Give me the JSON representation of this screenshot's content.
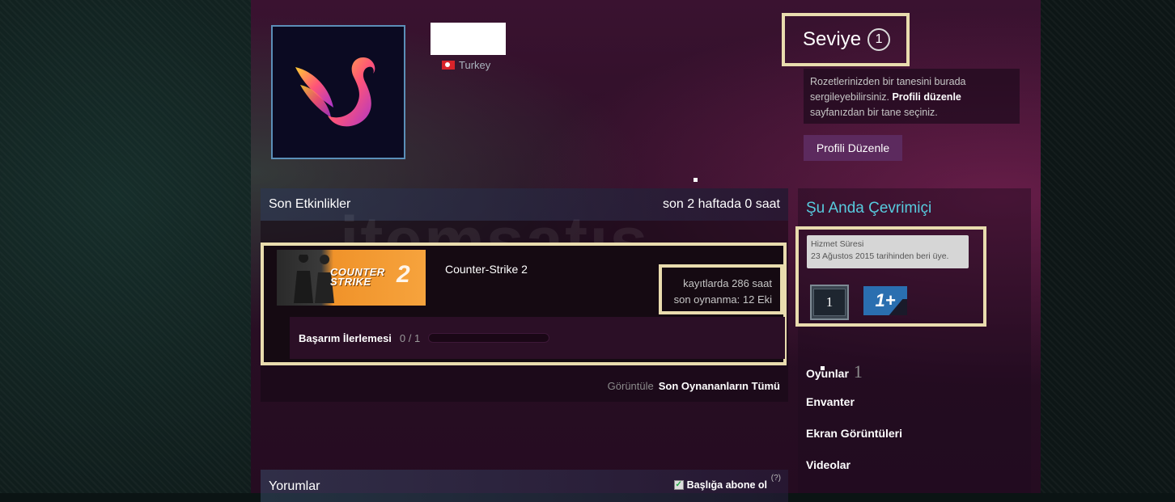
{
  "profile": {
    "country": "Turkey"
  },
  "level": {
    "label": "Seviye",
    "value": "1"
  },
  "badge_info": {
    "text": "Rozetlerinizden bir tanesini burada sergileyebilirsiniz.",
    "link_text": "Profili düzenle",
    "text_end": "sayfanızdan bir tane seçiniz."
  },
  "edit_profile_button": "Profili Düzenle",
  "activity": {
    "title": "Son Etkinlikler",
    "summary": "son 2 haftada 0 saat",
    "game": {
      "name": "Counter-Strike 2",
      "capsule_line1": "COUNTER",
      "capsule_line2": "STRIKE",
      "capsule_number": "2",
      "hours": "kayıtlarda 286 saat",
      "last_played": "son oynanma: 12 Eki",
      "achievement_label": "Başarım İlerlemesi",
      "achievement_count": "0 / 1",
      "achievement_progress": 0
    },
    "footer_label": "Görüntüle",
    "footer_link": "Son Oynananların Tümü"
  },
  "online": {
    "title": "Şu Anda Çevrimiçi",
    "tooltip_title": "Hizmet Süresi",
    "tooltip_text": "23 Ağustos 2015 tarihinden beri üye.",
    "badge1_label": "1",
    "badge2_label": "1+"
  },
  "sidebar": {
    "games_label": "Oyunlar",
    "games_count": "1",
    "inventory": "Envanter",
    "screenshots": "Ekran Görüntüleri",
    "videos": "Videolar"
  },
  "comments": {
    "title": "Yorumlar",
    "subscribe": "Başlığa abone ol",
    "help": "(?)"
  },
  "watermark": "itemsatış",
  "colors": {
    "highlight_border": "#e9dcae",
    "online_title": "#57cbde",
    "edit_button": "#5c2a5e"
  }
}
